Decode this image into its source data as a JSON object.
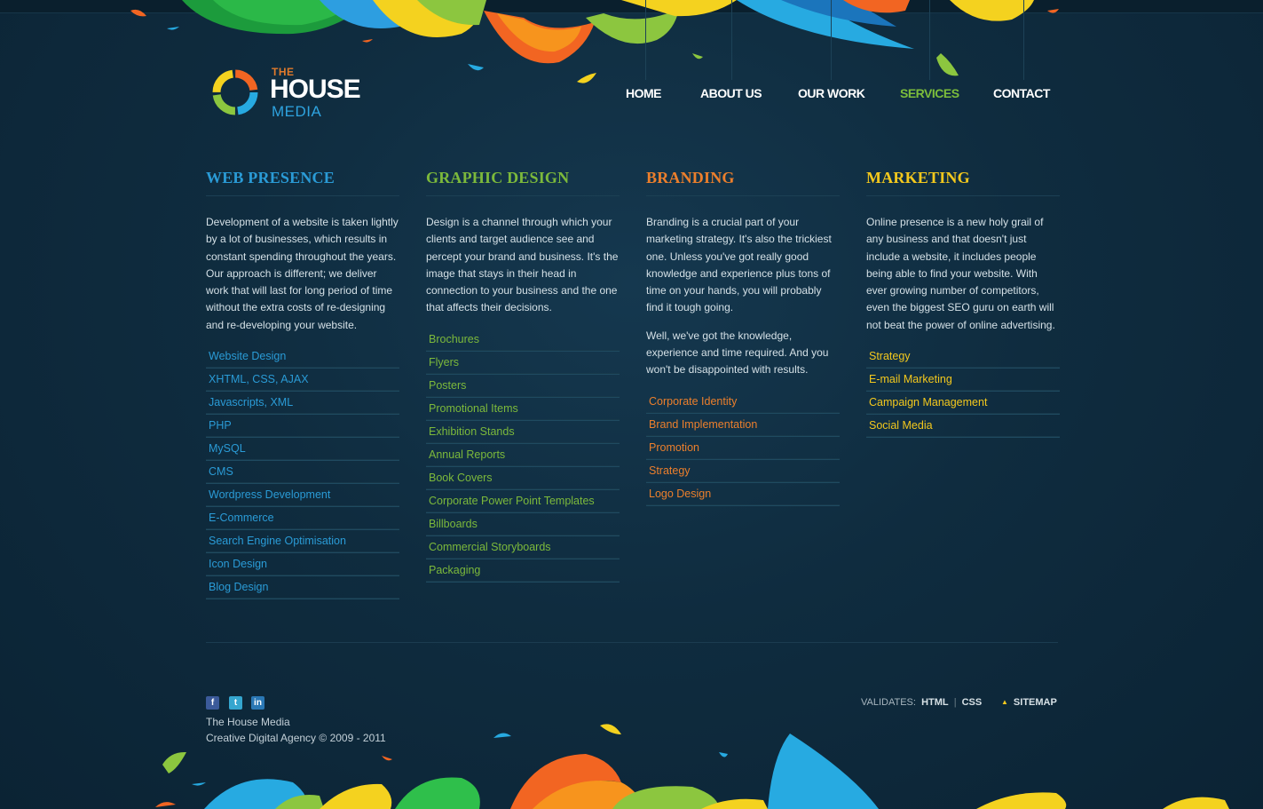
{
  "brand": {
    "the": "THE",
    "house": "HOUSE",
    "media": "MEDIA"
  },
  "nav": {
    "items": [
      {
        "label": "HOME"
      },
      {
        "label": "ABOUT US"
      },
      {
        "label": "OUR WORK"
      },
      {
        "label": "SERVICES",
        "active": true
      },
      {
        "label": "CONTACT"
      }
    ]
  },
  "columns": [
    {
      "title": "WEB PRESENCE",
      "color": "#2a9bd6",
      "paragraphs": [
        "Development of a website is taken lightly by a lot of businesses, which results in constant spending throughout the years. Our approach is different; we deliver work that will last for long period of time without the extra costs of re-designing and re-developing your website."
      ],
      "items": [
        "Website Design",
        "XHTML, CSS, AJAX",
        "Javascripts, XML",
        "PHP",
        "MySQL",
        "CMS",
        "Wordpress Development",
        "E-Commerce",
        "Search Engine Optimisation",
        "Icon Design",
        "Blog Design"
      ]
    },
    {
      "title": "GRAPHIC DESIGN",
      "color": "#7cb93b",
      "paragraphs": [
        "Design is a channel through which your clients and target audience see and percept your brand and business. It's the image that stays in their head in connection to your business and the one that affects their decisions."
      ],
      "items": [
        "Brochures",
        "Flyers",
        "Posters",
        "Promotional Items",
        "Exhibition Stands",
        "Annual Reports",
        "Book Covers",
        "Corporate Power Point Templates",
        "Billboards",
        "Commercial Storyboards",
        "Packaging"
      ]
    },
    {
      "title": "BRANDING",
      "color": "#ec7f2c",
      "paragraphs": [
        "Branding is a crucial part of your marketing strategy. It's also the trickiest one. Unless you've got really good knowledge and experience plus tons of time on your hands, you will probably find it tough going.",
        "Well, we've got the knowledge, experience and time required. And you won't be disappointed with results."
      ],
      "items": [
        "Corporate Identity",
        "Brand Implementation",
        "Promotion",
        "Strategy",
        "Logo Design"
      ]
    },
    {
      "title": "MARKETING",
      "color": "#f3c81d",
      "paragraphs": [
        "Online presence is a new holy grail of any business and that doesn't just include a website, it includes people being able to find your website. With ever growing number of competitors, even the biggest SEO guru on earth will not beat the power of online advertising."
      ],
      "items": [
        "Strategy",
        "E-mail Marketing",
        "Campaign Management",
        "Social Media"
      ]
    }
  ],
  "footer": {
    "social_icons": [
      "facebook-icon",
      "twitter-icon",
      "linkedin-icon"
    ],
    "company": "The House Media",
    "copyright": "Creative Digital Agency © 2009 - 2011",
    "validates_label": "VALIDATES:",
    "html_link": "HTML",
    "separator": "|",
    "css_link": "CSS",
    "sitemap": "SITEMAP"
  }
}
